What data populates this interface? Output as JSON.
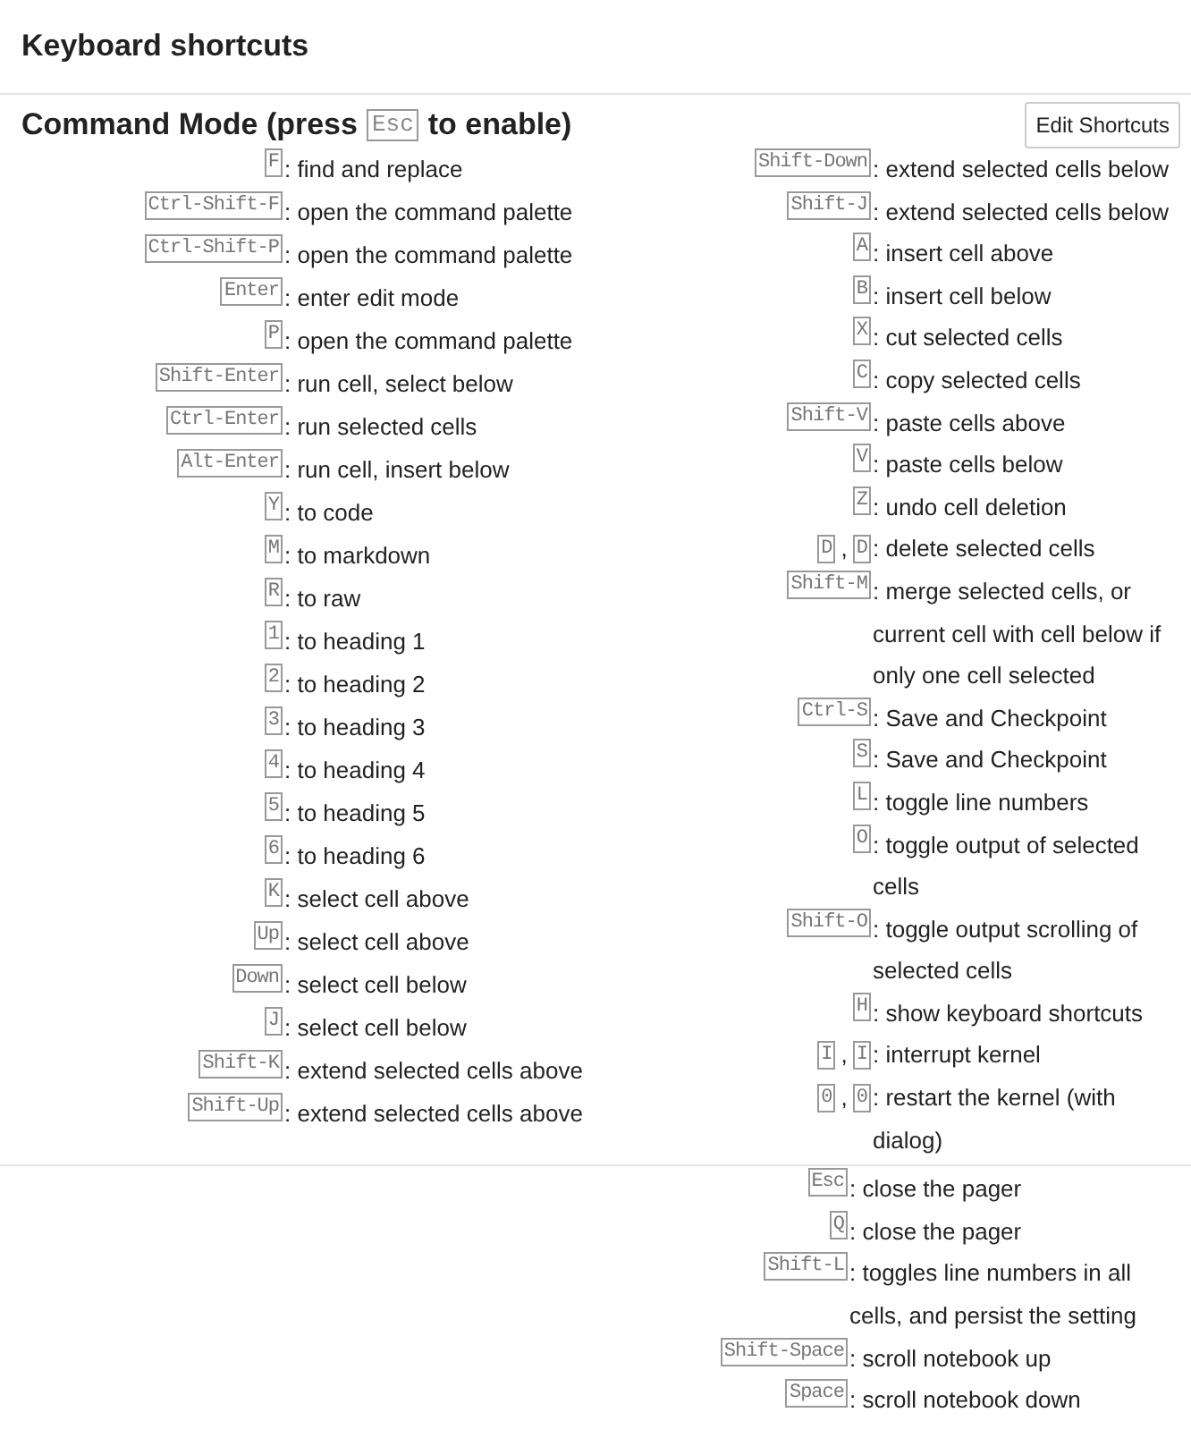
{
  "title": "Keyboard shortcuts",
  "mode": {
    "title_before": "Command Mode (press",
    "key": "Esc",
    "title_after": "to enable)",
    "edit_button": "Edit Shortcuts"
  },
  "columns": [
    [
      {
        "keys": [
          "F"
        ],
        "description": ": find and replace"
      },
      {
        "keys": [
          "Ctrl-Shift-F"
        ],
        "description": ": open the command palette"
      },
      {
        "keys": [
          "Ctrl-Shift-P"
        ],
        "description": ": open the command palette"
      },
      {
        "keys": [
          "Enter"
        ],
        "description": ": enter edit mode"
      },
      {
        "keys": [
          "P"
        ],
        "description": ": open the command palette"
      },
      {
        "keys": [
          "Shift-Enter"
        ],
        "description": ": run cell, select below"
      },
      {
        "keys": [
          "Ctrl-Enter"
        ],
        "description": ": run selected cells"
      },
      {
        "keys": [
          "Alt-Enter"
        ],
        "description": ": run cell, insert below"
      },
      {
        "keys": [
          "Y"
        ],
        "description": ": to code"
      },
      {
        "keys": [
          "M"
        ],
        "description": ": to markdown"
      },
      {
        "keys": [
          "R"
        ],
        "description": ": to raw"
      },
      {
        "keys": [
          "1"
        ],
        "description": ": to heading 1"
      },
      {
        "keys": [
          "2"
        ],
        "description": ": to heading 2"
      },
      {
        "keys": [
          "3"
        ],
        "description": ": to heading 3"
      },
      {
        "keys": [
          "4"
        ],
        "description": ": to heading 4"
      },
      {
        "keys": [
          "5"
        ],
        "description": ": to heading 5"
      },
      {
        "keys": [
          "6"
        ],
        "description": ": to heading 6"
      },
      {
        "keys": [
          "K"
        ],
        "description": ": select cell above"
      },
      {
        "keys": [
          "Up"
        ],
        "description": ": select cell above"
      },
      {
        "keys": [
          "Down"
        ],
        "description": ": select cell below"
      },
      {
        "keys": [
          "J"
        ],
        "description": ": select cell below"
      },
      {
        "keys": [
          "Shift-K"
        ],
        "description": ": extend selected cells above"
      },
      {
        "keys": [
          "Shift-Up"
        ],
        "description": ": extend selected cells above"
      }
    ],
    [
      {
        "keys": [
          "Shift-Down"
        ],
        "description": ": extend selected cells below"
      },
      {
        "keys": [
          "Shift-J"
        ],
        "description": ": extend selected cells below"
      },
      {
        "keys": [
          "A"
        ],
        "description": ": insert cell above"
      },
      {
        "keys": [
          "B"
        ],
        "description": ": insert cell below"
      },
      {
        "keys": [
          "X"
        ],
        "description": ": cut selected cells"
      },
      {
        "keys": [
          "C"
        ],
        "description": ": copy selected cells"
      },
      {
        "keys": [
          "Shift-V"
        ],
        "description": ": paste cells above"
      },
      {
        "keys": [
          "V"
        ],
        "description": ": paste cells below"
      },
      {
        "keys": [
          "Z"
        ],
        "description": ": undo cell deletion"
      },
      {
        "keys": [
          "D",
          "D"
        ],
        "separator": ",",
        "description": ": delete selected cells"
      },
      {
        "keys": [
          "Shift-M"
        ],
        "description": ": merge selected cells, or current cell with cell below if only one cell selected"
      },
      {
        "keys": [
          "Ctrl-S"
        ],
        "description": ": Save and Checkpoint"
      },
      {
        "keys": [
          "S"
        ],
        "description": ": Save and Checkpoint"
      },
      {
        "keys": [
          "L"
        ],
        "description": ": toggle line numbers"
      },
      {
        "keys": [
          "O"
        ],
        "description": ": toggle output of selected cells"
      },
      {
        "keys": [
          "Shift-O"
        ],
        "description": ": toggle output scrolling of selected cells"
      },
      {
        "keys": [
          "H"
        ],
        "description": ": show keyboard shortcuts"
      },
      {
        "keys": [
          "I",
          "I"
        ],
        "separator": ",",
        "description": ": interrupt kernel"
      },
      {
        "keys": [
          "0",
          "0"
        ],
        "separator": ",",
        "description": ": restart the kernel (with dialog)"
      }
    ]
  ],
  "pager_shortcuts": [
    {
      "keys": [
        "Esc"
      ],
      "description": ": close the pager"
    },
    {
      "keys": [
        "Q"
      ],
      "description": ": close the pager"
    },
    {
      "keys": [
        "Shift-L"
      ],
      "description": ": toggles line numbers in all cells, and persist the setting"
    },
    {
      "keys": [
        "Shift-Space"
      ],
      "description": ": scroll notebook up"
    },
    {
      "keys": [
        "Space"
      ],
      "description": ": scroll notebook down"
    }
  ]
}
